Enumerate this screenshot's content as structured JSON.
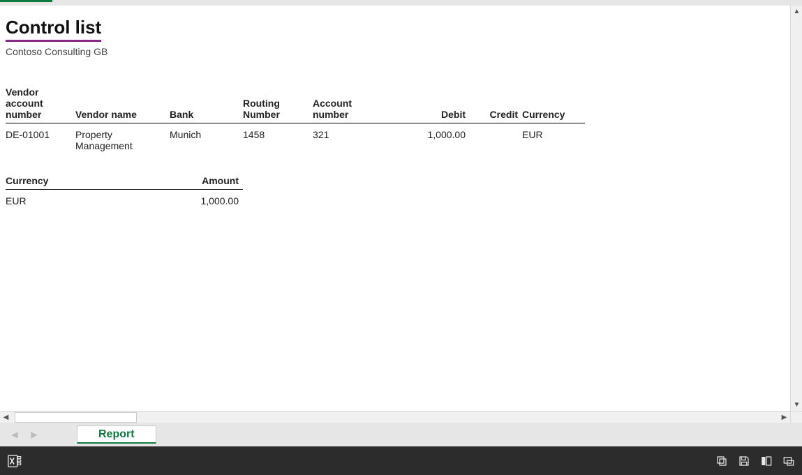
{
  "report": {
    "title": "Control list",
    "company": "Contoso Consulting GB"
  },
  "vendors": {
    "headers": {
      "vendor_account": "Vendor account number",
      "vendor_name": "Vendor name",
      "bank": "Bank",
      "routing": "Routing Number",
      "account": "Account number",
      "debit": "Debit",
      "credit": "Credit",
      "currency": "Currency"
    },
    "rows": [
      {
        "vendor_account": "DE-01001",
        "vendor_name": "Property Management",
        "bank": "Munich",
        "routing": "1458",
        "account": "321",
        "debit": "1,000.00",
        "credit": "",
        "currency": "EUR"
      }
    ]
  },
  "summary": {
    "headers": {
      "currency": "Currency",
      "amount": "Amount"
    },
    "rows": [
      {
        "currency": "EUR",
        "amount": "1,000.00"
      }
    ]
  },
  "tabs": {
    "report": "Report"
  }
}
